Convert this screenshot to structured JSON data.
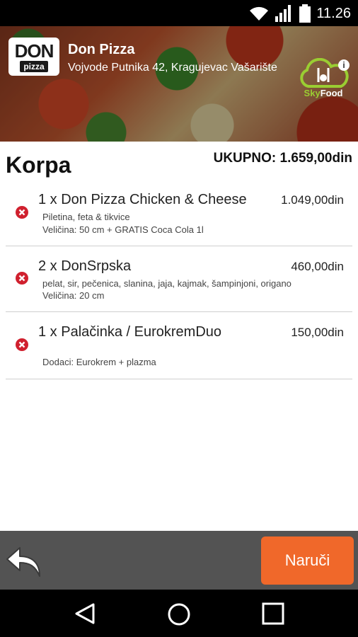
{
  "status_bar": {
    "time": "11.26"
  },
  "restaurant": {
    "logo_top": "DON",
    "logo_bottom": "pizza",
    "name": "Don Pizza",
    "address": "Vojvode Putnika 42, Kragujevac Vašarište",
    "partner_logo": {
      "part1": "Sky",
      "part2": "Food"
    }
  },
  "cart": {
    "title": "Korpa",
    "total": "UKUPNO: 1.659,00din",
    "items": [
      {
        "name": "1 x Don Pizza Chicken & Cheese",
        "price": "1.049,00din",
        "detail_1": "Piletina, feta & tikvice",
        "detail_2": "Veličina: 50 cm + GRATIS Coca Cola 1l"
      },
      {
        "name": "2 x DonSrpska",
        "price": "460,00din",
        "detail_1": "pelat, sir, pečenica, slanina, jaja, kajmak, šampinjoni, origano",
        "detail_2": "Veličina: 20 cm"
      },
      {
        "name": "1 x Palačinka / EurokremDuo",
        "price": "150,00din",
        "detail_1": "",
        "detail_2": "Dodaci: Eurokrem + plazma"
      }
    ]
  },
  "actions": {
    "order_label": "Naruči"
  },
  "colors": {
    "accent": "#f0682a",
    "remove": "#d0202e",
    "action_bar": "#535353"
  }
}
